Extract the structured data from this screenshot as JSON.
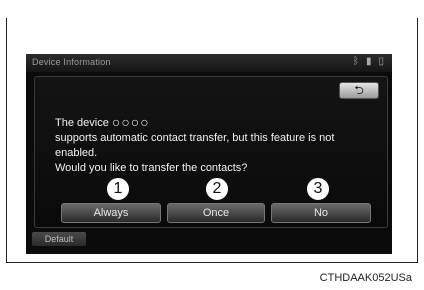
{
  "screen": {
    "header_title": "Device Information",
    "status_icons": [
      "bluetooth-icon",
      "signal-icon",
      "battery-icon"
    ],
    "back_button_icon": "return-arrow-icon",
    "dialog": {
      "line1_prefix": "The device ",
      "device_name": "○○○○",
      "line2": "supports automatic contact transfer, but this feature is not",
      "line3": "enabled.",
      "line4": "Would you like to transfer the contacts?"
    },
    "buttons": {
      "always": "Always",
      "once": "Once",
      "no": "No"
    },
    "default_tab": "Default"
  },
  "callouts": [
    "1",
    "2",
    "3"
  ],
  "caption": "CTHDAAK052USa"
}
